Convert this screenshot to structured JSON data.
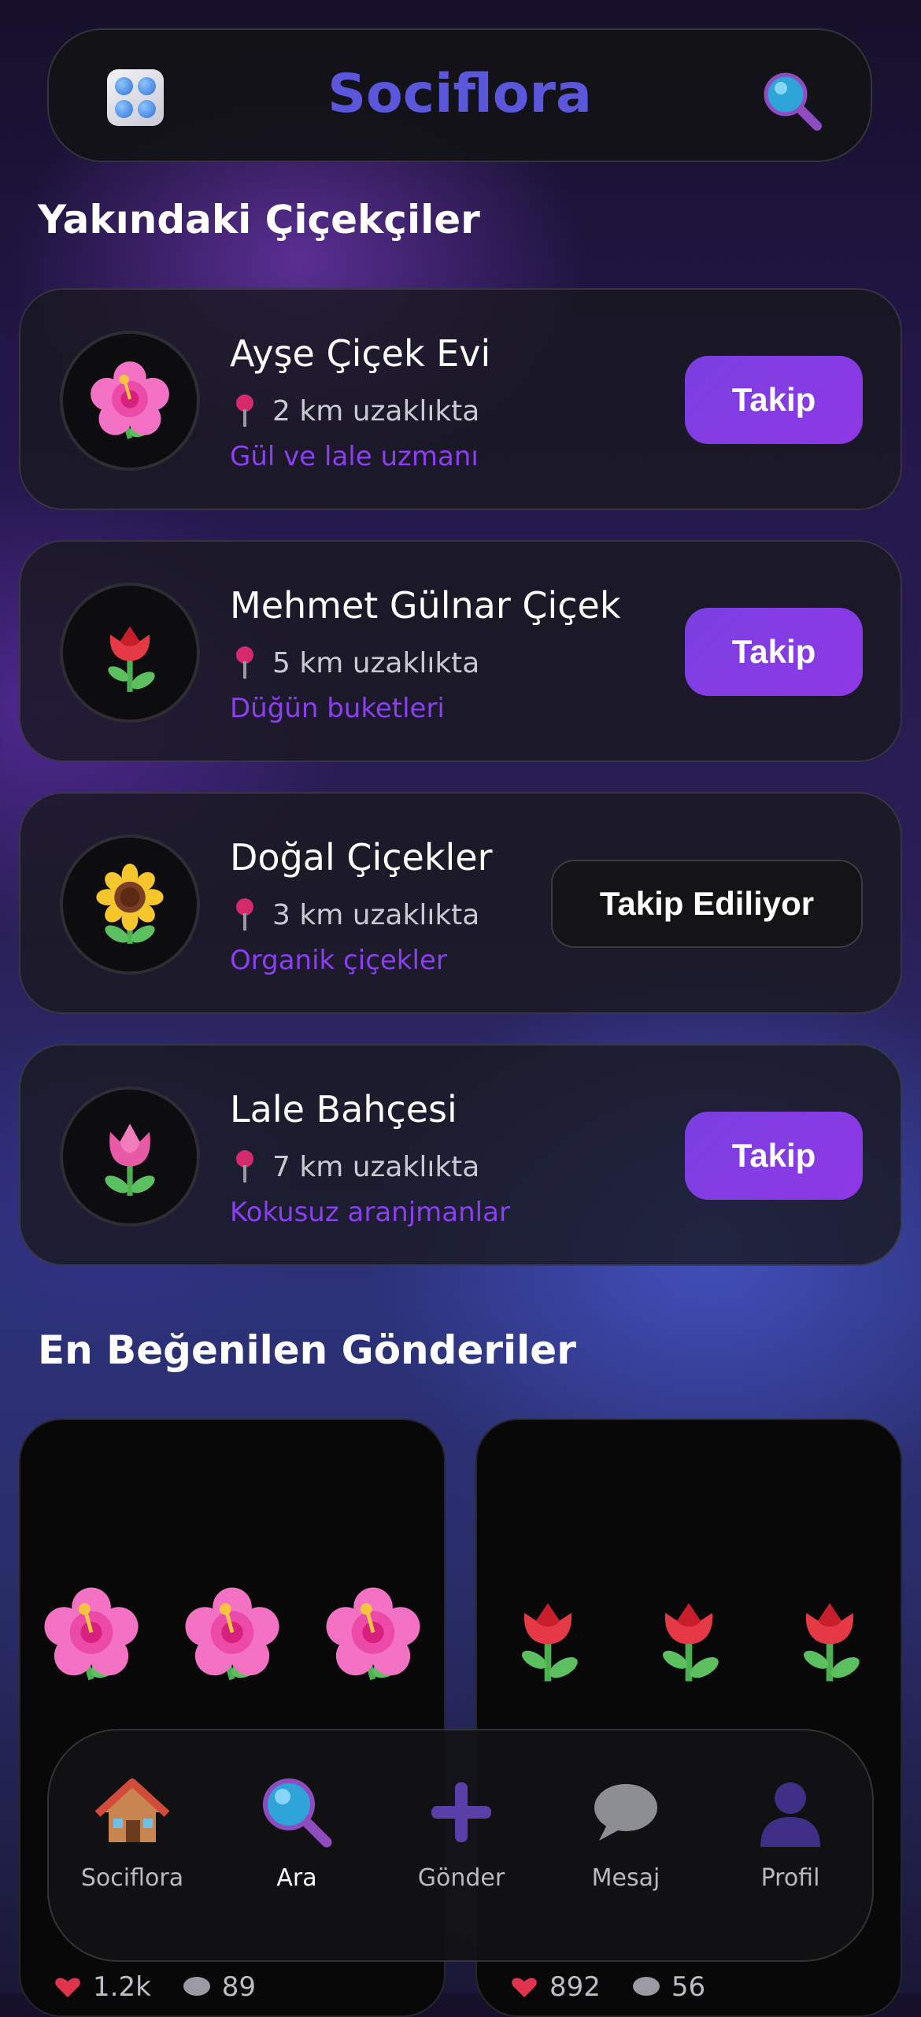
{
  "header": {
    "app_title": "Sociflora",
    "logo_icon": "blister-pack-icon",
    "search_icon": "magnifier-icon"
  },
  "nearby": {
    "title": "Yakındaki Çiçekçiler",
    "shops": [
      {
        "name": "Ayşe Çiçek Evi",
        "distance": "2 km uzaklıkta",
        "tag": "Gül ve lale uzmanı",
        "button": "Takip",
        "following": false,
        "icon": "hibiscus-icon"
      },
      {
        "name": "Mehmet Gülnar Çiçek",
        "distance": "5 km uzaklıkta",
        "tag": "Düğün buketleri",
        "button": "Takip",
        "following": false,
        "icon": "rose-icon"
      },
      {
        "name": "Doğal Çiçekler",
        "distance": "3 km uzaklıkta",
        "tag": "Organik çiçekler",
        "button": "Takip Ediliyor",
        "following": true,
        "icon": "sunflower-icon"
      },
      {
        "name": "Lale Bahçesi",
        "distance": "7 km uzaklıkta",
        "tag": "Kokusuz aranjmanlar",
        "button": "Takip",
        "following": false,
        "icon": "tulip-icon"
      }
    ]
  },
  "popular": {
    "title": "En Beğenilen Gönderiler",
    "posts": [
      {
        "likes": "1.2k",
        "comments": "89",
        "icon": "hibiscus-icon"
      },
      {
        "likes": "892",
        "comments": "56",
        "icon": "rose-icon"
      }
    ]
  },
  "nav": {
    "items": [
      {
        "label": "Sociflora",
        "icon": "house-icon",
        "active": false
      },
      {
        "label": "Ara",
        "icon": "search-icon",
        "active": true
      },
      {
        "label": "Gönder",
        "icon": "plus-icon",
        "active": false
      },
      {
        "label": "Mesaj",
        "icon": "speech-bubble-icon",
        "active": false
      },
      {
        "label": "Profil",
        "icon": "person-icon",
        "active": false
      }
    ]
  },
  "colors": {
    "accent": "#8a3ff0",
    "title_blue": "#5b57dc",
    "card_bg": "#18181e"
  }
}
